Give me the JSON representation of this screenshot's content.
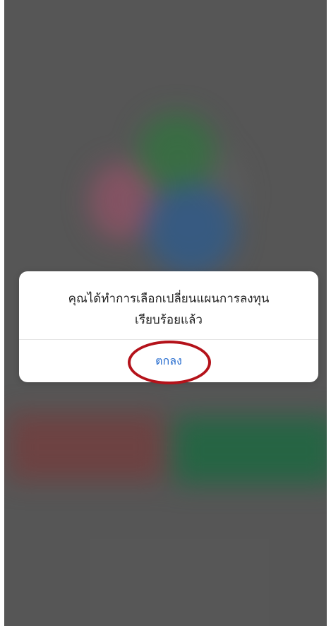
{
  "dialog": {
    "message_line1": "คุณได้ทำการเลือกเปลี่ยนแผนการลงทุน",
    "message_line2": "เรียบร้อยแล้ว",
    "ok_label": "ตกลง"
  },
  "colors": {
    "ok_button_text": "#2a6fd0",
    "highlight_ring": "#b4121a",
    "backdrop": "#5a5a5a"
  }
}
